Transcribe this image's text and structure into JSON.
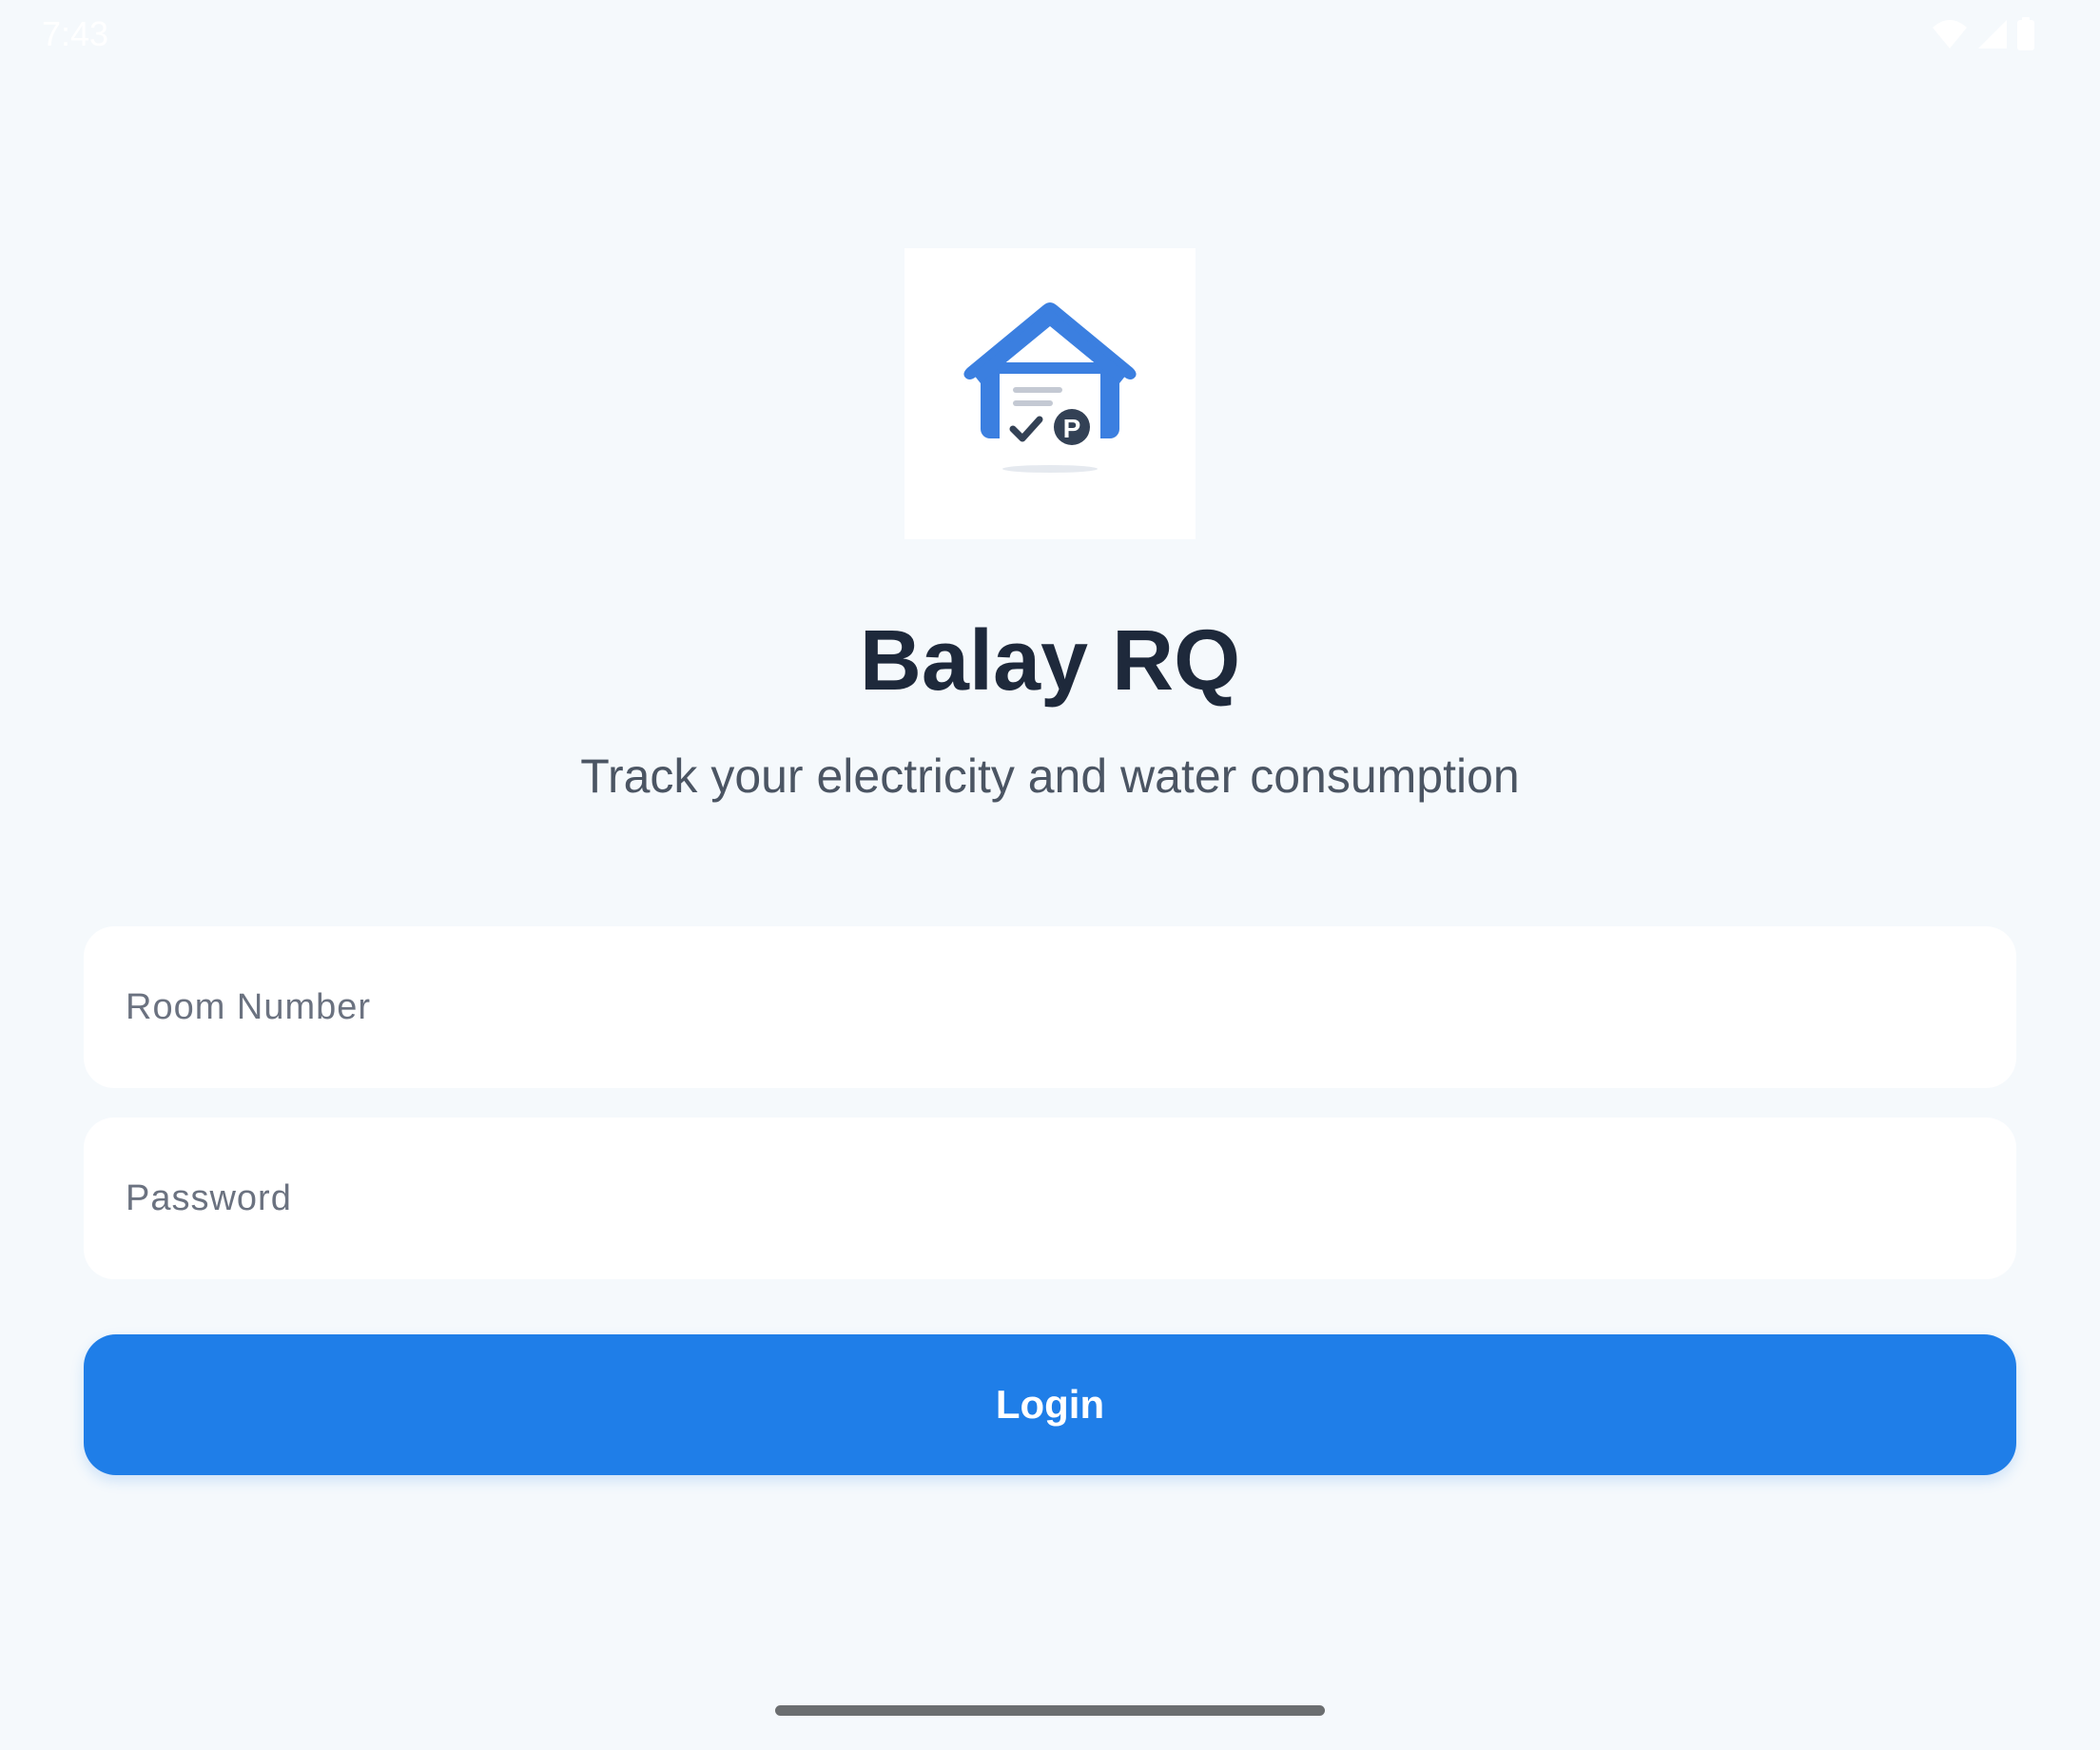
{
  "status_bar": {
    "time": "7:43",
    "icons": [
      "wifi-icon",
      "cellular-signal-icon",
      "battery-icon"
    ]
  },
  "logo": {
    "icon": "house-receipt-icon",
    "badge_letter": "P",
    "colors": {
      "house": "#3b7fe0",
      "badge": "#334155"
    }
  },
  "app": {
    "title": "Balay RQ",
    "subtitle": "Track your electricity and water consumption"
  },
  "form": {
    "room_number": {
      "value": "",
      "placeholder": "Room Number"
    },
    "password": {
      "value": "",
      "placeholder": "Password"
    },
    "login_label": "Login"
  },
  "colors": {
    "background": "#f5f9fc",
    "accent": "#1f7ee8",
    "title": "#1e293b",
    "subtitle": "#4b5563"
  }
}
